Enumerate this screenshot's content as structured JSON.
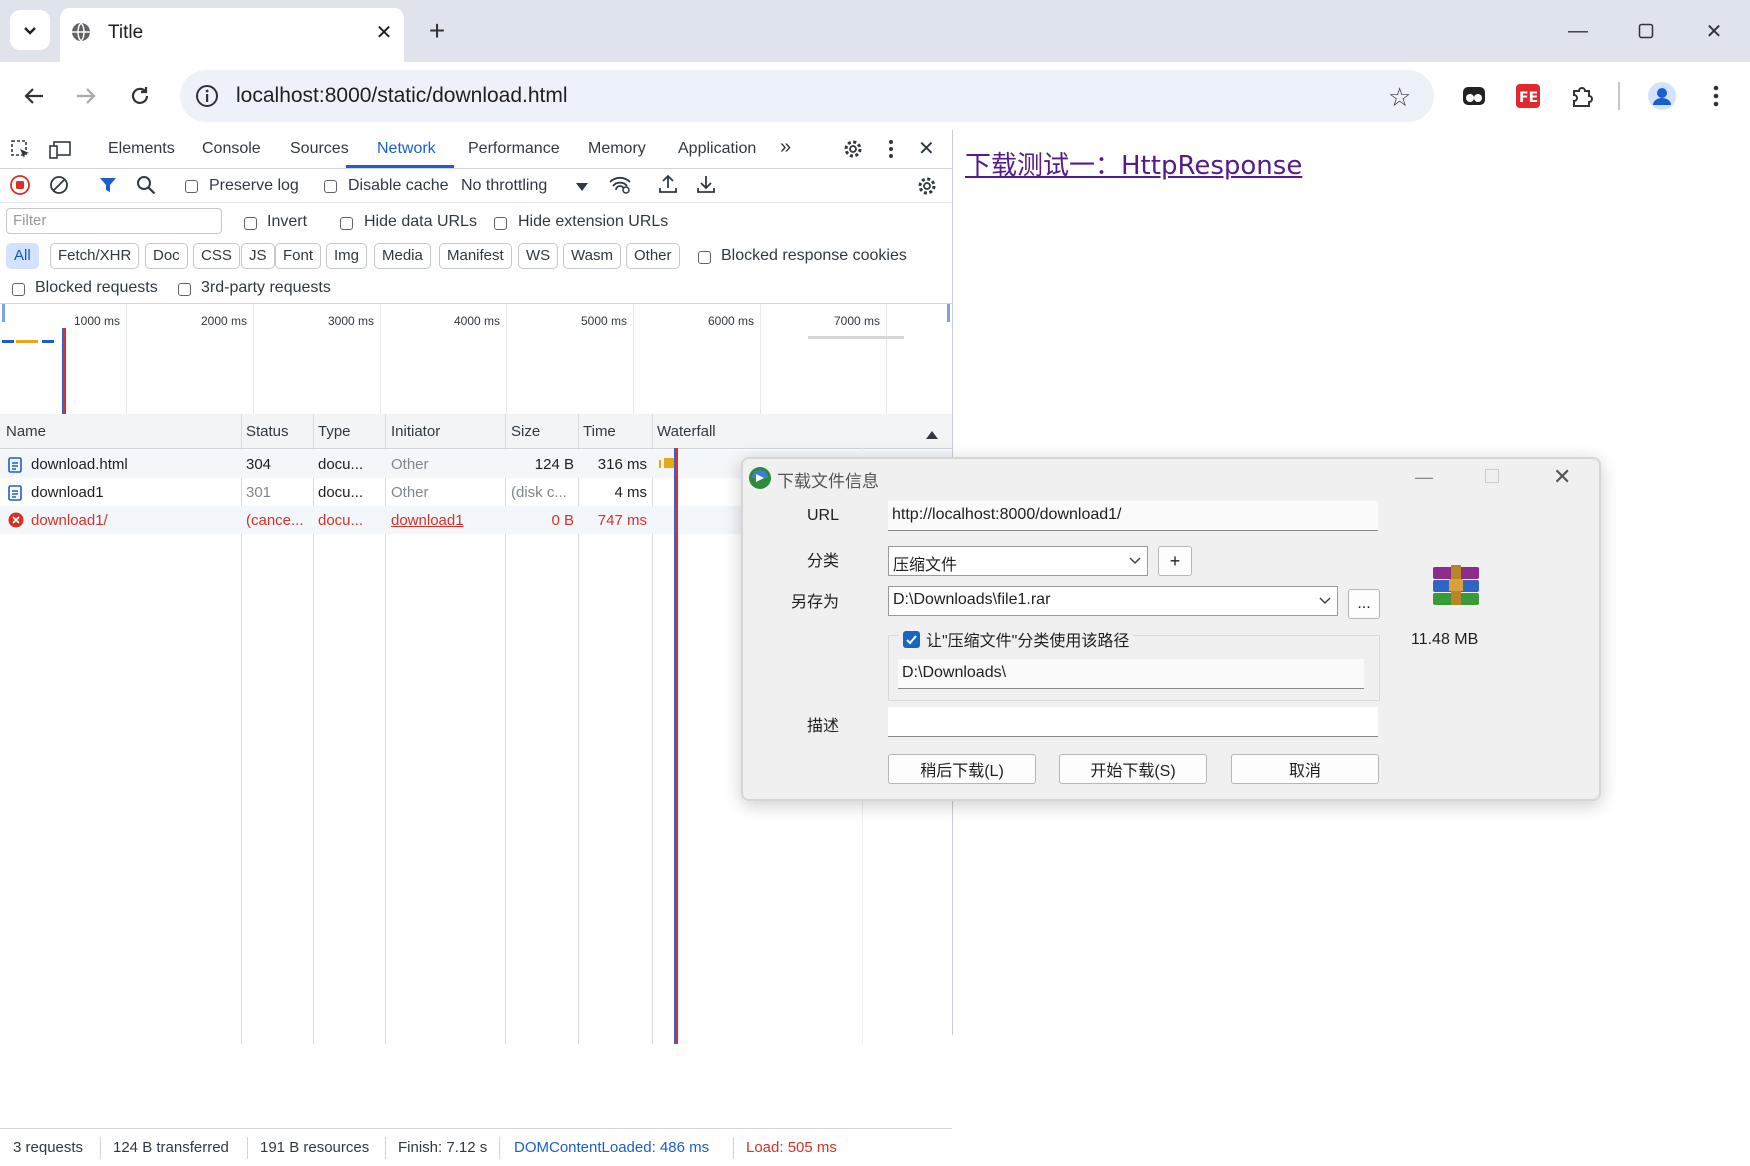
{
  "browser": {
    "tab_title": "Title",
    "url": "localhost:8000/static/download.html"
  },
  "devtools": {
    "tabs": [
      "Elements",
      "Console",
      "Sources",
      "Network",
      "Performance",
      "Memory",
      "Application"
    ],
    "more": "»",
    "toolbar": {
      "preserve_log": "Preserve log",
      "disable_cache": "Disable cache",
      "throttling": "No throttling"
    },
    "filter": {
      "placeholder": "Filter",
      "invert": "Invert",
      "hide_data": "Hide data URLs",
      "hide_ext": "Hide extension URLs",
      "chips": [
        "All",
        "Fetch/XHR",
        "Doc",
        "CSS",
        "JS",
        "Font",
        "Img",
        "Media",
        "Manifest",
        "WS",
        "Wasm",
        "Other"
      ],
      "blocked_cookies": "Blocked response cookies",
      "blocked_requests": "Blocked requests",
      "third_party": "3rd-party requests"
    },
    "overview_ticks": [
      "1000 ms",
      "2000 ms",
      "3000 ms",
      "4000 ms",
      "5000 ms",
      "6000 ms",
      "7000 ms"
    ],
    "columns": [
      "Name",
      "Status",
      "Type",
      "Initiator",
      "Size",
      "Time",
      "Waterfall"
    ],
    "rows": [
      {
        "name": "download.html",
        "status": "304",
        "type": "docu...",
        "initiator": "Other",
        "size": "124 B",
        "time": "316 ms"
      },
      {
        "name": "download1",
        "status": "301",
        "type": "docu...",
        "initiator": "Other",
        "size": "(disk c...",
        "time": "4 ms"
      },
      {
        "name": "download1/",
        "status": "(cance...",
        "type": "docu...",
        "initiator": "download1",
        "size": "0 B",
        "time": "747 ms"
      }
    ],
    "status_bar": {
      "requests": "3 requests",
      "transferred": "124 B transferred",
      "resources": "191 B resources",
      "finish": "Finish: 7.12 s",
      "dcl": "DOMContentLoaded: 486 ms",
      "load": "Load: 505 ms"
    }
  },
  "page": {
    "link": "下载测试一：HttpResponse"
  },
  "dialog": {
    "title": "下载文件信息",
    "url_label": "URL",
    "url_value": "http://localhost:8000/download1/",
    "category_label": "分类",
    "category_value": "压缩文件",
    "add_btn": "+",
    "saveas_label": "另存为",
    "saveas_value": "D:\\Downloads\\file1.rar",
    "browse_btn": "...",
    "remember_label": "让\"压缩文件\"分类使用该路径",
    "remember_path": "D:\\Downloads\\",
    "desc_label": "描述",
    "file_size": "11.48  MB",
    "btn_later": "稍后下载(L)",
    "btn_start": "开始下载(S)",
    "btn_cancel": "取消"
  },
  "colors": {
    "accent": "#1a5fcf",
    "error": "#d93025",
    "link_visited": "#551a8b"
  }
}
